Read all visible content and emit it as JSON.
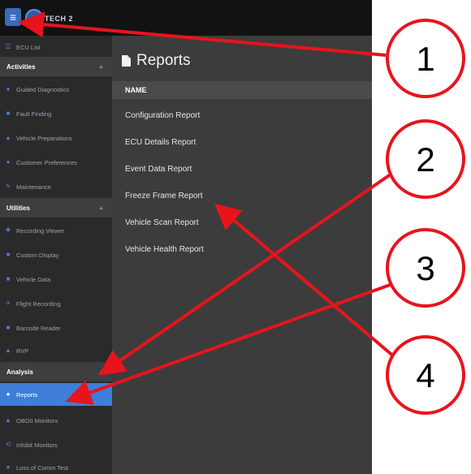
{
  "header": {
    "menu_icon": "hamburger-icon",
    "brand_text": "TECH 2"
  },
  "sidebar": {
    "ecu_list": "ECU List",
    "activities": {
      "title": "Activities",
      "items": [
        "Guided Diagnostics",
        "Fault Finding",
        "Vehicle Preparations",
        "Customer Preferences",
        "Maintenance"
      ]
    },
    "utilities": {
      "title": "Utilities",
      "items": [
        "Recording Viewer",
        "Custom Display",
        "Vehicle Data",
        "Flight Recording",
        "Barcode Reader",
        "RVP"
      ]
    },
    "analysis": {
      "title": "Analysis",
      "items": [
        "Reports",
        "OBDII Monitors",
        "Inhibit Monitors",
        "Loss of Comm Test"
      ],
      "active_item": "Reports"
    }
  },
  "main": {
    "title": "Reports",
    "column_header": "NAME",
    "reports": [
      "Configuration Report",
      "ECU Details Report",
      "Event Data Report",
      "Freeze Frame Report",
      "Vehicle Scan Report",
      "Vehicle Health Report"
    ]
  },
  "callouts": [
    "1",
    "2",
    "3",
    "4"
  ],
  "colors": {
    "accent": "#3f7ed8",
    "callout": "#e8141c",
    "sidebar_bg": "#2a2a2a",
    "content_bg": "#3c3c3c"
  }
}
